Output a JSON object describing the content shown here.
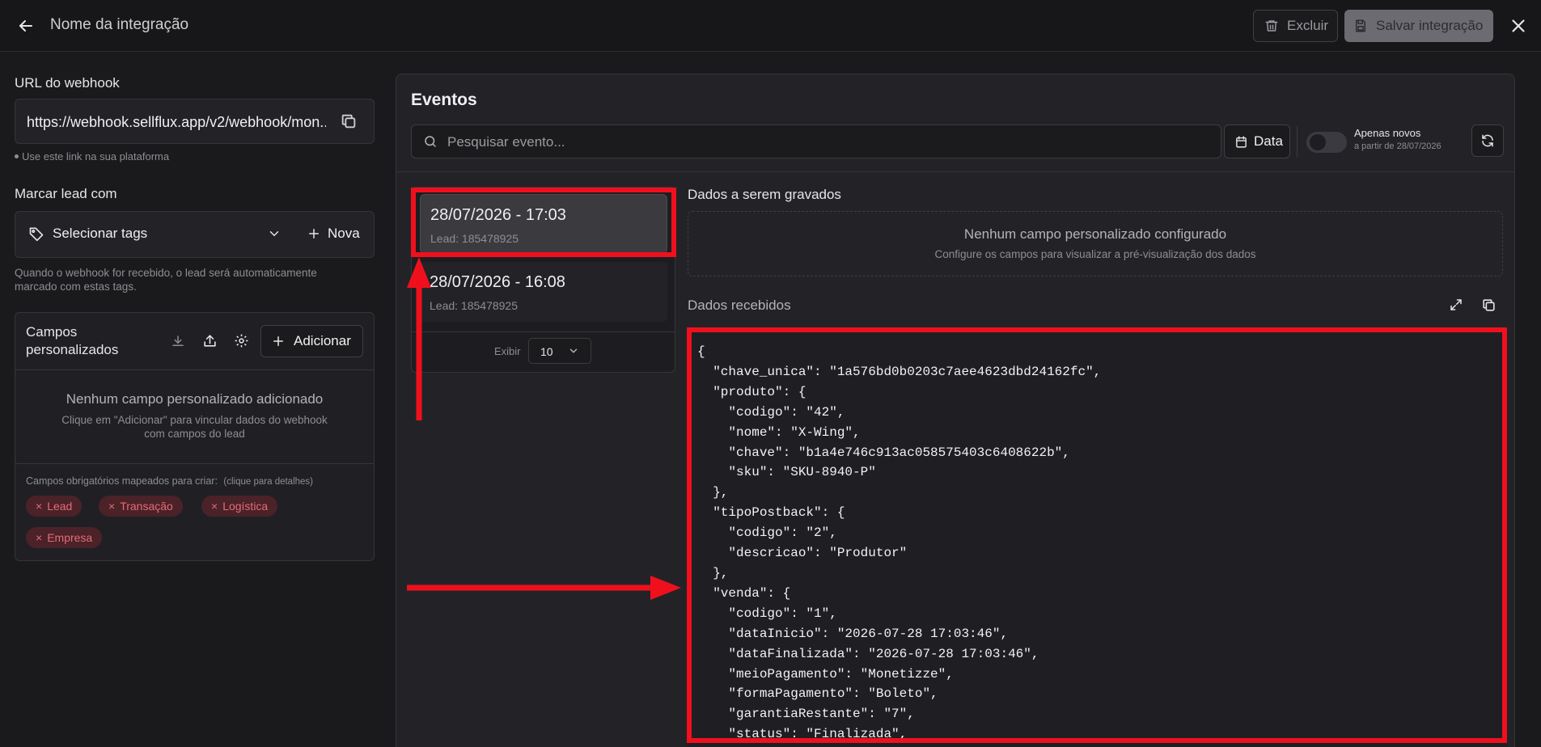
{
  "header": {
    "title": "Nome da integração",
    "delete_label": "Excluir",
    "save_label": "Salvar integração"
  },
  "webhook": {
    "label": "URL do webhook",
    "url": "https://webhook.sellflux.app/v2/webhook/mon...",
    "hint": "Use este link na sua plataforma"
  },
  "tags": {
    "label": "Marcar lead com",
    "select_placeholder": "Selecionar tags",
    "new_label": "Nova",
    "description_line1": "Quando o webhook for recebido, o lead será automaticamente",
    "description_line2": "marcado com estas tags."
  },
  "custom_fields": {
    "title_line1": "Campos",
    "title_line2": "personalizados",
    "add_label": "Adicionar",
    "empty_title": "Nenhum campo personalizado adicionado",
    "empty_desc_line1": "Clique em \"Adicionar\" para vincular dados do webhook",
    "empty_desc_line2": "com campos do lead",
    "required_label": "Campos obrigatórios mapeados para criar:",
    "required_hint": "(clique para detalhes)",
    "chips": [
      "Lead",
      "Transação",
      "Logística",
      "Empresa"
    ]
  },
  "events": {
    "title": "Eventos",
    "search_placeholder": "Pesquisar evento...",
    "date_label": "Data",
    "toggle_title": "Apenas novos",
    "toggle_subtitle": "a partir de 28/07/2026",
    "list": [
      {
        "date": "28/07/2026 - 17:03",
        "lead": "Lead: 185478925"
      },
      {
        "date": "28/07/2026 - 16:08",
        "lead": "Lead: 185478925"
      }
    ],
    "show_label": "Exibir",
    "show_value": "10"
  },
  "data_to_save": {
    "title": "Dados a serem gravados",
    "empty_title": "Nenhum campo personalizado configurado",
    "empty_desc": "Configure os campos para visualizar a pré-visualização dos dados"
  },
  "received": {
    "title": "Dados recebidos",
    "json_lines": [
      "{",
      "  \"chave_unica\": \"1a576bd0b0203c7aee4623dbd24162fc\",",
      "  \"produto\": {",
      "    \"codigo\": \"42\",",
      "    \"nome\": \"X-Wing\",",
      "    \"chave\": \"b1a4e746c913ac058575403c6408622b\",",
      "    \"sku\": \"SKU-8940-P\"",
      "  },",
      "  \"tipoPostback\": {",
      "    \"codigo\": \"2\",",
      "    \"descricao\": \"Produtor\"",
      "  },",
      "  \"venda\": {",
      "    \"codigo\": \"1\",",
      "    \"dataInicio\": \"2026-07-28 17:03:46\",",
      "    \"dataFinalizada\": \"2026-07-28 17:03:46\",",
      "    \"meioPagamento\": \"Monetizze\",",
      "    \"formaPagamento\": \"Boleto\",",
      "    \"garantiaRestante\": \"7\",",
      "    \"status\": \"Finalizada\","
    ]
  },
  "colors": {
    "annotation_red": "#f0101d",
    "chip_red": "#e66a78"
  }
}
